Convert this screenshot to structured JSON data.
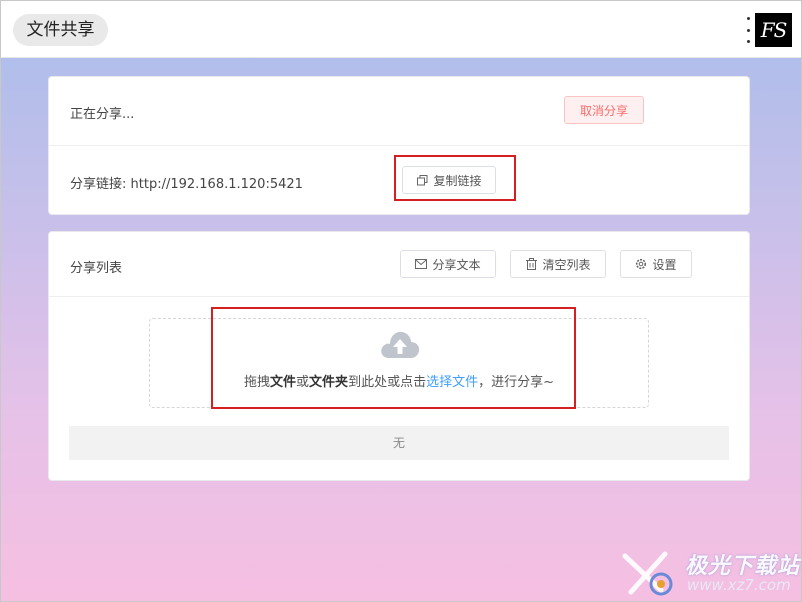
{
  "window": {
    "title": "文件共享",
    "logo_text": "FS"
  },
  "share_status": {
    "status_text": "正在分享...",
    "cancel_label": "取消分享",
    "link_label": "分享链接: http://192.168.1.120:5421",
    "copy_label": "复制链接"
  },
  "share_list": {
    "title": "分享列表",
    "share_text_label": "分享文本",
    "clear_label": "清空列表",
    "settings_label": "设置",
    "drop_prefix": "拖拽",
    "drop_files": "文件",
    "drop_or": "或",
    "drop_folder": "文件夹",
    "drop_middle": "到此处或点击",
    "drop_link": "选择文件",
    "drop_suffix": "，进行分享~",
    "empty_text": "无"
  },
  "watermark": {
    "line1": "极光下载站",
    "line2": "www.xz7.com"
  },
  "colors": {
    "accent": "#409eff",
    "danger": "#f56c6c",
    "highlight": "#d42020"
  }
}
